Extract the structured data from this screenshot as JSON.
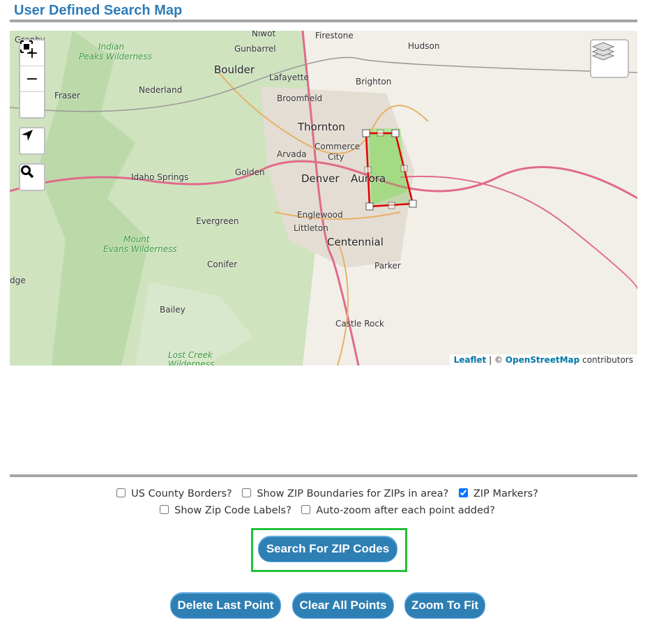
{
  "title": "User Defined Search Map",
  "map": {
    "labels": {
      "niwot": "Niwot",
      "firestone": "Firestone",
      "gunbarrel": "Gunbarrel",
      "hudson": "Hudson",
      "boulder": "Boulder",
      "lafayette": "Lafayette",
      "indian": "Indian",
      "peaks": "Peaks Wilderness",
      "brighton": "Brighton",
      "fraser": "Fraser",
      "nederland": "Nederland",
      "broomfield": "Broomfield",
      "thornton": "Thornton",
      "commerce": "Commerce",
      "city": "City",
      "arvada": "Arvada",
      "golden": "Golden",
      "idaho": "Idaho Springs",
      "denver": "Denver",
      "aurora": "Aurora",
      "englewood": "Englewood",
      "evergreen": "Evergreen",
      "littleton": "Littleton",
      "centennial": "Centennial",
      "mount": "Mount",
      "evans": "Evans Wilderness",
      "parker": "Parker",
      "conifer": "Conifer",
      "bailey": "Bailey",
      "castle": "Castle Rock",
      "lostcreek": "Lost Creek",
      "wilderness": "Wilderness",
      "edge": "dge",
      "granby": "Granby"
    },
    "zoom_in": "+",
    "zoom_out": "−",
    "attribution": {
      "leaflet": "Leaflet",
      "sep": " | © ",
      "osm": "OpenStreetMap",
      "suffix": " contributors"
    },
    "polygon_color": "#e00000"
  },
  "options": [
    {
      "label": "US County Borders?",
      "checked": false
    },
    {
      "label": "Show ZIP Boundaries for ZIPs in area?",
      "checked": false
    },
    {
      "label": "ZIP Markers?",
      "checked": true
    },
    {
      "label": "Show Zip Code Labels?",
      "checked": false
    },
    {
      "label": "Auto-zoom after each point added?",
      "checked": false
    }
  ],
  "buttons": {
    "search": "Search For ZIP Codes",
    "delete": "Delete Last Point",
    "clear": "Clear All Points",
    "fit": "Zoom To Fit"
  }
}
